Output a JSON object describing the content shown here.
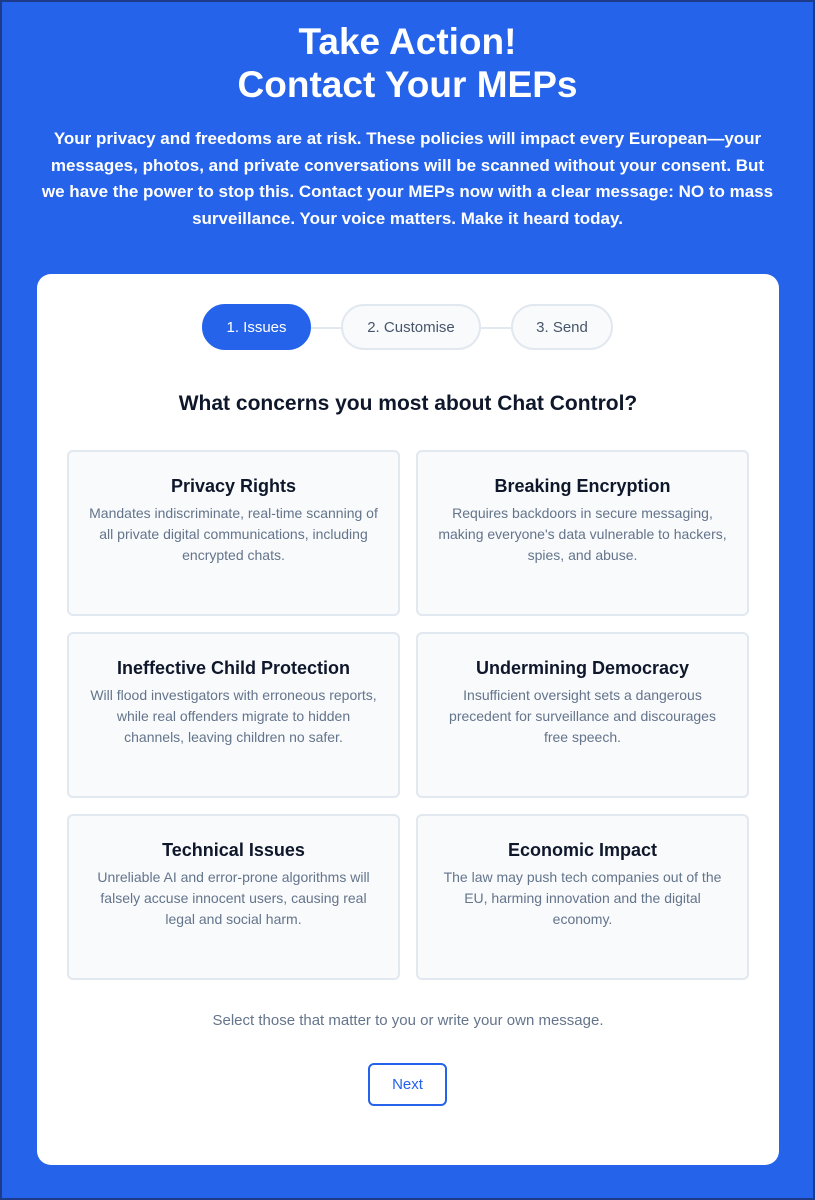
{
  "hero": {
    "title_line1": "Take Action!",
    "title_line2": "Contact Your MEPs",
    "text": "Your privacy and freedoms are at risk. These policies will impact every European—your messages, photos, and private conversations will be scanned without your consent. But we have the power to stop this. Contact your MEPs now with a clear message: NO to mass surveillance. Your voice matters. Make it heard today."
  },
  "steps": [
    {
      "label": "1. Issues",
      "active": true
    },
    {
      "label": "2. Customise",
      "active": false
    },
    {
      "label": "3. Send",
      "active": false
    }
  ],
  "question": "What concerns you most about Chat Control?",
  "concerns": [
    {
      "title": "Privacy Rights",
      "description": "Mandates indiscriminate, real-time scanning of all private digital communications, including encrypted chats."
    },
    {
      "title": "Breaking Encryption",
      "description": "Requires backdoors in secure messaging, making everyone's data vulnerable to hackers, spies, and abuse."
    },
    {
      "title": "Ineffective Child Protection",
      "description": "Will flood investigators with erroneous reports, while real offenders migrate to hidden channels, leaving children no safer."
    },
    {
      "title": "Undermining Democracy",
      "description": "Insufficient oversight sets a dangerous precedent for surveillance and discourages free speech."
    },
    {
      "title": "Technical Issues",
      "description": "Unreliable AI and error-prone algorithms will falsely accuse innocent users, causing real legal and social harm."
    },
    {
      "title": "Economic Impact",
      "description": "The law may push tech companies out of the EU, harming innovation and the digital economy."
    }
  ],
  "hint": "Select those that matter to you or write your own message.",
  "next_label": "Next",
  "colors": {
    "brand_blue": "#2563eb",
    "card_bg": "#ffffff",
    "tile_bg": "#f8fafc",
    "border": "#e2e8f0",
    "muted_text": "#64748b"
  }
}
